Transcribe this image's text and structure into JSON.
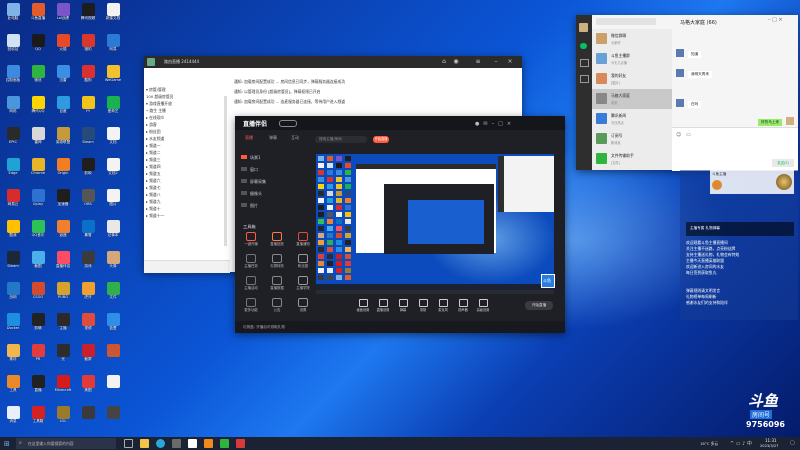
{
  "desktop_icons": [
    {
      "label": "此电脑",
      "color": "#7fb2e6"
    },
    {
      "label": "斗鱼直播",
      "color": "#e25b2b"
    },
    {
      "label": "Lol战绩",
      "color": "#7a55c9"
    },
    {
      "label": "腾讯视频",
      "color": "#1d1d1d"
    },
    {
      "label": "新建文档",
      "color": "#f2f2f2"
    },
    {
      "label": "回收站",
      "color": "#cfe3f5"
    },
    {
      "label": "QQ",
      "color": "#1a1a1a"
    },
    {
      "label": "火狐",
      "color": "#e84a28"
    },
    {
      "label": "猎豹",
      "color": "#d9372b"
    },
    {
      "label": "网易",
      "color": "#2a7ad6"
    },
    {
      "label": "控制面板",
      "color": "#3d8be0"
    },
    {
      "label": "微信",
      "color": "#2fb53f"
    },
    {
      "label": "迅雷",
      "color": "#3a8ee6"
    },
    {
      "label": "酷狗",
      "color": "#d93131"
    },
    {
      "label": "WeGame",
      "color": "#f2c12e"
    },
    {
      "label": "网络",
      "color": "#4a96dd"
    },
    {
      "label": "腾讯QQ",
      "color": "#ffd500"
    },
    {
      "label": "百度",
      "color": "#2c9be0"
    },
    {
      "label": "YY",
      "color": "#f0c419"
    },
    {
      "label": "爱奇艺",
      "color": "#18b34f"
    },
    {
      "label": "EPIC",
      "color": "#2a2a2a"
    },
    {
      "label": "雷神",
      "color": "#d8d8d8"
    },
    {
      "label": "英雄联盟",
      "color": "#c49a3a"
    },
    {
      "label": "Steam",
      "color": "#264a7a"
    },
    {
      "label": "文档",
      "color": "#f3f3f3"
    },
    {
      "label": "Edge",
      "color": "#1fa3d6"
    },
    {
      "label": "Chrome",
      "color": "#e7b52a"
    },
    {
      "label": "Origin",
      "color": "#f27d23"
    },
    {
      "label": "剪映",
      "color": "#1e1e1e"
    },
    {
      "label": "文档2",
      "color": "#f3f3f3"
    },
    {
      "label": "网易云",
      "color": "#d82b2b"
    },
    {
      "label": "Uplay",
      "color": "#2d71d1"
    },
    {
      "label": "加速器",
      "color": "#1e1e1e"
    },
    {
      "label": "OBS",
      "color": "#555"
    },
    {
      "label": "图片",
      "color": "#f3f3f3"
    },
    {
      "label": "酷我",
      "color": "#ffc000"
    },
    {
      "label": "QQ音乐",
      "color": "#2ec254"
    },
    {
      "label": "逍遥",
      "color": "#f08030"
    },
    {
      "label": "暴雪",
      "color": "#0a70c8"
    },
    {
      "label": "记事本",
      "color": "#e8e8e8"
    },
    {
      "label": "Steam",
      "color": "#1b2838"
    },
    {
      "label": "截图",
      "color": "#4ab0ea"
    },
    {
      "label": "直播伴侣",
      "color": "#ff4c65"
    },
    {
      "label": "游戏",
      "color": "#3b3b3b"
    },
    {
      "label": "头像",
      "color": "#d7a77c"
    },
    {
      "label": "战网",
      "color": "#2478c8"
    },
    {
      "label": "CSGO",
      "color": "#d44a2c"
    },
    {
      "label": "PUBG",
      "color": "#d5a22c"
    },
    {
      "label": "虎牙",
      "color": "#f0a030"
    },
    {
      "label": "文件",
      "color": "#2fb04a"
    },
    {
      "label": "Docker",
      "color": "#1e8fe0"
    },
    {
      "label": "剪辑",
      "color": "#222"
    },
    {
      "label": "主播",
      "color": "#2a2a2a"
    },
    {
      "label": "视频",
      "color": "#e04c3c"
    },
    {
      "label": "蓝叠",
      "color": "#2f8ee8"
    },
    {
      "label": "素材",
      "color": "#f2b64c"
    },
    {
      "label": "PR",
      "color": "#e33c3c"
    },
    {
      "label": "光",
      "color": "#2d2d2d"
    },
    {
      "label": "截屏",
      "color": "#c8202c"
    },
    {
      "label": "",
      "color": "#cc5533"
    },
    {
      "label": "工具",
      "color": "#e88a2a"
    },
    {
      "label": "直播",
      "color": "#212121"
    },
    {
      "label": "Minecraft",
      "color": "#d41c1c"
    },
    {
      "label": "美图",
      "color": "#e23a3a"
    },
    {
      "label": "",
      "color": "#f3f3f3"
    },
    {
      "label": "消息",
      "color": "#e8f0ff"
    },
    {
      "label": "工具箱",
      "color": "#d42222"
    },
    {
      "label": "LOL",
      "color": "#9a7b2a"
    },
    {
      "label": "",
      "color": "#3a3a3a"
    },
    {
      "label": "",
      "color": "#444"
    }
  ],
  "livehelper": {
    "title": "路由直播 2414444",
    "tree": [
      "▾ 房管/管理",
      "  100 超级房管员",
      "▾ 游戏直播开放",
      "  • 路生  主播",
      "  ▸ 在线观众",
      "  ▸ 游客",
      "  ▸ 粉丝团",
      "  ▸ 水友频道",
      "  ▸ 频道一",
      "  ▸ 频道二",
      "  ▸ 频道三",
      "  ▸ 频道四",
      "  ▸ 频道五",
      "  ▸ 频道六",
      "  ▸ 频道七",
      "  ▸ 频道八",
      "  ▸ 频道九",
      "  ▸ 频道十",
      "  ▸ 频道十一"
    ],
    "messages": [
      "通知: 加载房间配置成功 ...  房间信息已同步，弹幕服务器连接成功",
      "通知: 以管理员身份 [超级房管员]，弹幕权限已开启",
      "通知: 加载房间配置成功 ...  连麦服务器已连接，等待用户进入频道"
    ]
  },
  "stream": {
    "logo": "直播伴侣",
    "tabs": [
      "直播",
      "弹幕",
      "互动"
    ],
    "search_placeholder": "搜索主播/房间",
    "start_button": "开始直播",
    "scene_items": [
      "场景1",
      "窗口",
      "屏幕采集",
      "摄像头",
      "图片"
    ],
    "tools_title": "工具箱",
    "tools": [
      "一键开播",
      "直播回放",
      "直播通知",
      "主播任务",
      "礼物特效",
      "粉丝团",
      "主播活动",
      "直播数据",
      "主播学院",
      "更多功能",
      "公告",
      "设置"
    ],
    "bottom_actions": [
      "画面设置",
      "直播设置",
      "弹幕",
      "录制",
      "麦克风",
      "扬声器",
      "高级设置"
    ],
    "status": "礼物盒: 开播后可领取礼物",
    "live_button": "开始直播",
    "footer_logo": "斗鱼"
  },
  "wechat": {
    "title": "马格大家庭 (66)",
    "chats": [
      {
        "name": "微信群聊",
        "preview": "大家好"
      },
      {
        "name": "斗鱼主播群",
        "preview": "今天几点播"
      },
      {
        "name": "我的好友",
        "preview": "[图片]"
      },
      {
        "name": "马格大家庭",
        "preview": "收到"
      },
      {
        "name": "腾讯新闻",
        "preview": "今日热点"
      },
      {
        "name": "订阅号",
        "preview": "新消息"
      },
      {
        "name": "文件传输助手",
        "preview": "[文件]"
      }
    ],
    "messages": [
      "知道",
      "我明天再来",
      "在吗",
      "好的马上来"
    ],
    "send_label": "发送(S)"
  },
  "overlay": {
    "name": "斗鱼主播",
    "caption": "主播专属 礼物弹幕",
    "chat": [
      "欢迎观看斗鱼主播直播间",
      "关注主播不迷路，点亮粉丝牌",
      "支持主播送礼物，礼物会有特效",
      "主播今天直播英雄联盟",
      "欢迎新进入房间的水友",
      "每日签到获取鱼丸",
      "",
      "",
      "弹幕规则请文明发言",
      "礼物榜单每周刷新",
      "感谢水友们的支持和陪伴"
    ]
  },
  "douyu_badge": {
    "brand": "斗鱼",
    "label": "房间号",
    "room_number": "9756096"
  },
  "taskbar": {
    "search_placeholder": "在这里输入你要搜索的内容",
    "weather": "18°C 多云",
    "time": "11:31",
    "date": "2023/3/27"
  }
}
